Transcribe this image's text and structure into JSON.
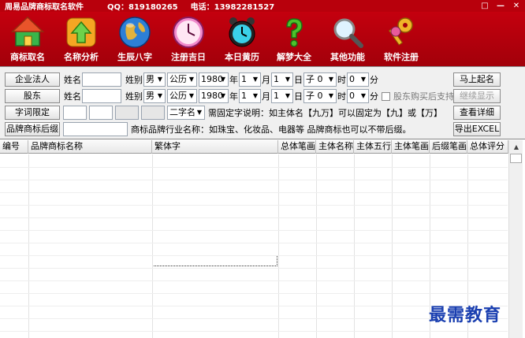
{
  "titlebar": {
    "app_title": "周易品牌商标取名软件",
    "qq": "QQ：819180265",
    "phone": "电话：13982281527",
    "min_icon": "minimize-icon",
    "restore_icon": "restore-icon",
    "close_icon": "close-icon"
  },
  "toolbar": {
    "items": [
      {
        "label": "商标取名",
        "icon": "house-icon"
      },
      {
        "label": "名称分析",
        "icon": "arrow-up-icon"
      },
      {
        "label": "生辰八字",
        "icon": "globe-icon"
      },
      {
        "label": "注册吉日",
        "icon": "clock-icon"
      },
      {
        "label": "本日黄历",
        "icon": "alarm-clock-icon"
      },
      {
        "label": "解梦大全",
        "icon": "question-icon"
      },
      {
        "label": "其他功能",
        "icon": "magnifier-icon"
      },
      {
        "label": "软件注册",
        "icon": "keys-icon"
      }
    ]
  },
  "form": {
    "row1": {
      "btn": "企业法人",
      "name_label": "姓名",
      "name_value": "",
      "gender_label": "姓别",
      "gender": "男",
      "calendar": "公历",
      "year": "1980",
      "year_unit": "年",
      "month": "1",
      "month_unit": "月",
      "day": "1",
      "day_unit": "日",
      "hour": "子 0",
      "hour_unit": "时",
      "minute": "0",
      "minute_unit": "分"
    },
    "row2": {
      "btn": "股东",
      "name_label": "姓名",
      "name_value": "",
      "gender_label": "姓别",
      "gender": "男",
      "calendar": "公历",
      "year": "1980",
      "year_unit": "年",
      "month": "1",
      "month_unit": "月",
      "day": "1",
      "day_unit": "日",
      "hour": "子 0",
      "hour_unit": "时",
      "minute": "0",
      "minute_unit": "分",
      "checkbox_label": "股东购买后支持"
    },
    "row3": {
      "btn": "字词限定",
      "name_type": "二字名",
      "hint": "需固定字说明：如主体名【九万】可以固定为【九】或【万】"
    },
    "row4": {
      "btn": "品牌商标后缀",
      "hint": "商标品牌行业名称：如珠宝、化妆品、电器等 品牌商标也可以不带后缀。"
    },
    "actions": {
      "start": "马上起名",
      "continue": "继续显示",
      "details": "查看详细",
      "export": "导出EXCEL"
    }
  },
  "table": {
    "columns": [
      "编号",
      "品牌商标名称",
      "繁体字",
      "总体笔画",
      "主体名称",
      "主体五行",
      "主体笔画",
      "后缀笔画",
      "总体评分"
    ],
    "rows": []
  },
  "watermark": "最需教育"
}
